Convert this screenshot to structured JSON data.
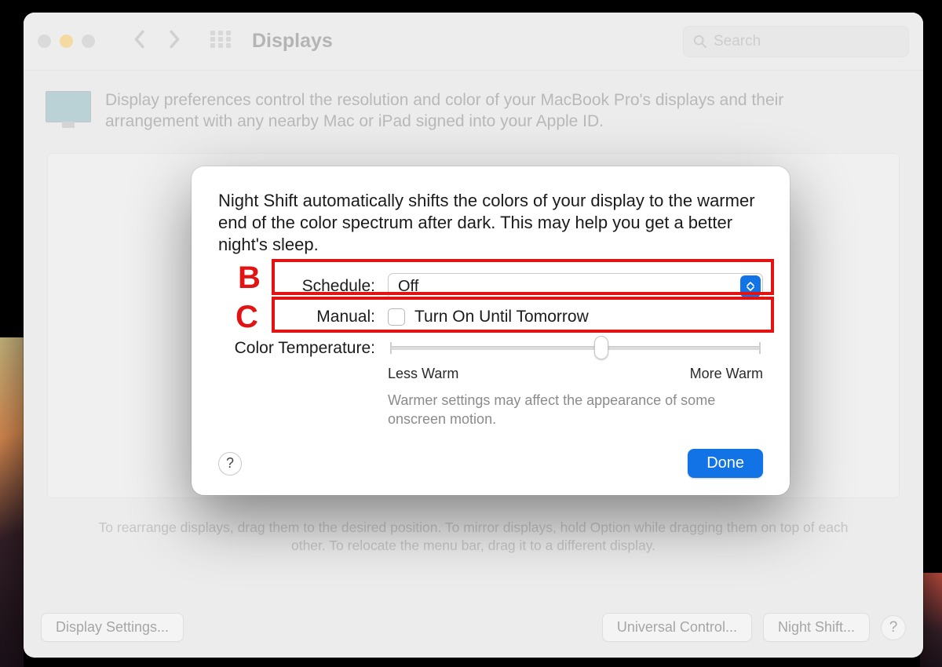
{
  "window": {
    "title": "Displays",
    "search_placeholder": "Search",
    "header_desc": "Display preferences control the resolution and color of your MacBook Pro's displays and their arrangement with any nearby Mac or iPad signed into your Apple ID.",
    "hint": "To rearrange displays, drag them to the desired position. To mirror displays, hold Option while dragging them on top of each other. To relocate the menu bar, drag it to a different display.",
    "buttons": {
      "display_settings": "Display Settings...",
      "universal_control": "Universal Control...",
      "night_shift": "Night Shift..."
    }
  },
  "sheet": {
    "description": "Night Shift automatically shifts the colors of your display to the warmer end of the color spectrum after dark. This may help you get a better night's sleep.",
    "schedule_label": "Schedule:",
    "schedule_value": "Off",
    "manual_label": "Manual:",
    "manual_checkbox_label": "Turn On Until Tomorrow",
    "color_temp_label": "Color Temperature:",
    "slider_min_label": "Less Warm",
    "slider_max_label": "More Warm",
    "slider_note": "Warmer settings may affect the appearance of some onscreen motion.",
    "done_label": "Done",
    "help_glyph": "?"
  },
  "annotations": {
    "b": "B",
    "c": "C"
  }
}
